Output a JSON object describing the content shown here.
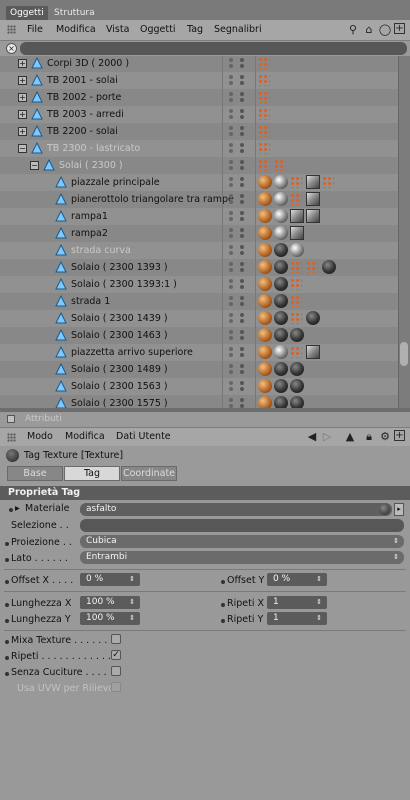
{
  "tabs": {
    "active": "Oggetti",
    "inactive": "Struttura"
  },
  "menubar": {
    "items": [
      "File",
      "Modifica",
      "Vista",
      "Oggetti",
      "Tag",
      "Segnalibri"
    ]
  },
  "tree": {
    "rows": [
      {
        "label": "Corpi 3D ( 2000 )",
        "expander": "+",
        "indent": 0,
        "dim": false
      },
      {
        "label": "TB 2001 - solai",
        "expander": "+",
        "indent": 0,
        "dim": false
      },
      {
        "label": "TB 2002 - porte",
        "expander": "+",
        "indent": 0,
        "dim": false
      },
      {
        "label": "TB 2003 - arredi",
        "expander": "+",
        "indent": 0,
        "dim": false
      },
      {
        "label": "TB 2200 - solai",
        "expander": "+",
        "indent": 0,
        "dim": false
      },
      {
        "label": "TB 2300 - lastricato",
        "expander": "-",
        "indent": 0,
        "dim": true
      },
      {
        "label": "Solai ( 2300 )",
        "expander": "-",
        "indent": 1,
        "dim": true
      },
      {
        "label": "piazzale principale",
        "expander": "",
        "indent": 2,
        "dim": false
      },
      {
        "label": "pianerottolo triangolare tra rampe",
        "expander": "",
        "indent": 2,
        "dim": false
      },
      {
        "label": "rampa1",
        "expander": "",
        "indent": 2,
        "dim": false
      },
      {
        "label": "rampa2",
        "expander": "",
        "indent": 2,
        "dim": false
      },
      {
        "label": "strada curva",
        "expander": "",
        "indent": 2,
        "dim": true
      },
      {
        "label": "Solaio ( 2300 1393 )",
        "expander": "",
        "indent": 2,
        "dim": false
      },
      {
        "label": "Solaio ( 2300 1393:1 )",
        "expander": "",
        "indent": 2,
        "dim": false
      },
      {
        "label": "strada 1",
        "expander": "",
        "indent": 2,
        "dim": false
      },
      {
        "label": "Solaio ( 2300 1439 )",
        "expander": "",
        "indent": 2,
        "dim": false
      },
      {
        "label": "Solaio ( 2300 1463 )",
        "expander": "",
        "indent": 2,
        "dim": false
      },
      {
        "label": "piazzetta arrivo superiore",
        "expander": "",
        "indent": 2,
        "dim": false
      },
      {
        "label": "Solaio ( 2300 1489 )",
        "expander": "",
        "indent": 2,
        "dim": false
      },
      {
        "label": "Solaio ( 2300 1563 )",
        "expander": "",
        "indent": 2,
        "dim": false
      },
      {
        "label": "Solaio ( 2300 1575 )",
        "expander": "",
        "indent": 2,
        "dim": false
      }
    ]
  },
  "attributes": {
    "title": "Attributi",
    "menu": [
      "Modo",
      "Modifica",
      "Dati Utente"
    ],
    "object_name": "Tag Texture [Texture]",
    "subtabs": [
      "Base",
      "Tag",
      "Coordinate"
    ],
    "section": "Proprietà Tag",
    "material_label": "Materiale",
    "material_value": "asfalto",
    "selection_label": "Selezione . .",
    "projection_label": "Proiezione . .",
    "projection_value": "Cubica",
    "side_label": "Lato . . . . . .",
    "side_value": "Entrambi",
    "offset_x_label": "Offset X . . . .",
    "offset_x_value": "0 %",
    "offset_y_label": "Offset Y",
    "offset_y_value": "0 %",
    "length_x_label": "Lunghezza X",
    "length_x_value": "100 %",
    "repeat_x_label": "Ripeti X",
    "repeat_x_value": "1",
    "length_y_label": "Lunghezza Y",
    "length_y_value": "100 %",
    "repeat_y_label": "Ripeti Y",
    "repeat_y_value": "1",
    "mix_label": "Mixa Texture . . . . . .",
    "repeat_label": "Ripeti . . . . . . . . . . . .",
    "seamless_label": "Senza Cuciture . . . .",
    "uvw_label": "Usa UVW per Rilievo",
    "checkmark": "✓"
  }
}
